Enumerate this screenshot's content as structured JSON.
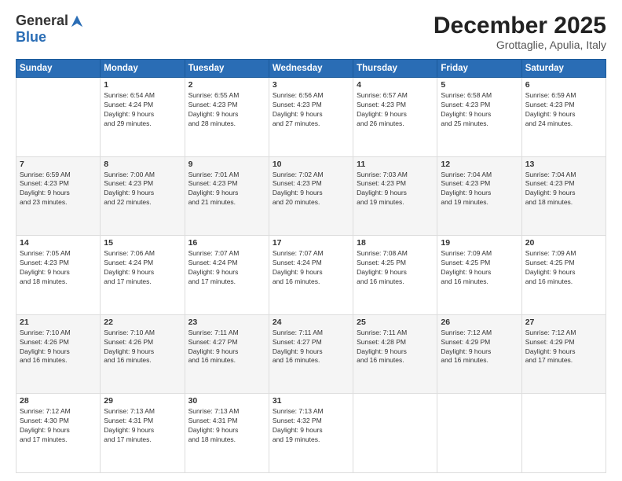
{
  "logo": {
    "general": "General",
    "blue": "Blue"
  },
  "header": {
    "month": "December 2025",
    "location": "Grottaglie, Apulia, Italy"
  },
  "weekdays": [
    "Sunday",
    "Monday",
    "Tuesday",
    "Wednesday",
    "Thursday",
    "Friday",
    "Saturday"
  ],
  "weeks": [
    [
      {
        "day": "",
        "info": ""
      },
      {
        "day": "1",
        "info": "Sunrise: 6:54 AM\nSunset: 4:24 PM\nDaylight: 9 hours\nand 29 minutes."
      },
      {
        "day": "2",
        "info": "Sunrise: 6:55 AM\nSunset: 4:23 PM\nDaylight: 9 hours\nand 28 minutes."
      },
      {
        "day": "3",
        "info": "Sunrise: 6:56 AM\nSunset: 4:23 PM\nDaylight: 9 hours\nand 27 minutes."
      },
      {
        "day": "4",
        "info": "Sunrise: 6:57 AM\nSunset: 4:23 PM\nDaylight: 9 hours\nand 26 minutes."
      },
      {
        "day": "5",
        "info": "Sunrise: 6:58 AM\nSunset: 4:23 PM\nDaylight: 9 hours\nand 25 minutes."
      },
      {
        "day": "6",
        "info": "Sunrise: 6:59 AM\nSunset: 4:23 PM\nDaylight: 9 hours\nand 24 minutes."
      }
    ],
    [
      {
        "day": "7",
        "info": "Sunrise: 6:59 AM\nSunset: 4:23 PM\nDaylight: 9 hours\nand 23 minutes."
      },
      {
        "day": "8",
        "info": "Sunrise: 7:00 AM\nSunset: 4:23 PM\nDaylight: 9 hours\nand 22 minutes."
      },
      {
        "day": "9",
        "info": "Sunrise: 7:01 AM\nSunset: 4:23 PM\nDaylight: 9 hours\nand 21 minutes."
      },
      {
        "day": "10",
        "info": "Sunrise: 7:02 AM\nSunset: 4:23 PM\nDaylight: 9 hours\nand 20 minutes."
      },
      {
        "day": "11",
        "info": "Sunrise: 7:03 AM\nSunset: 4:23 PM\nDaylight: 9 hours\nand 19 minutes."
      },
      {
        "day": "12",
        "info": "Sunrise: 7:04 AM\nSunset: 4:23 PM\nDaylight: 9 hours\nand 19 minutes."
      },
      {
        "day": "13",
        "info": "Sunrise: 7:04 AM\nSunset: 4:23 PM\nDaylight: 9 hours\nand 18 minutes."
      }
    ],
    [
      {
        "day": "14",
        "info": "Sunrise: 7:05 AM\nSunset: 4:23 PM\nDaylight: 9 hours\nand 18 minutes."
      },
      {
        "day": "15",
        "info": "Sunrise: 7:06 AM\nSunset: 4:24 PM\nDaylight: 9 hours\nand 17 minutes."
      },
      {
        "day": "16",
        "info": "Sunrise: 7:07 AM\nSunset: 4:24 PM\nDaylight: 9 hours\nand 17 minutes."
      },
      {
        "day": "17",
        "info": "Sunrise: 7:07 AM\nSunset: 4:24 PM\nDaylight: 9 hours\nand 16 minutes."
      },
      {
        "day": "18",
        "info": "Sunrise: 7:08 AM\nSunset: 4:25 PM\nDaylight: 9 hours\nand 16 minutes."
      },
      {
        "day": "19",
        "info": "Sunrise: 7:09 AM\nSunset: 4:25 PM\nDaylight: 9 hours\nand 16 minutes."
      },
      {
        "day": "20",
        "info": "Sunrise: 7:09 AM\nSunset: 4:25 PM\nDaylight: 9 hours\nand 16 minutes."
      }
    ],
    [
      {
        "day": "21",
        "info": "Sunrise: 7:10 AM\nSunset: 4:26 PM\nDaylight: 9 hours\nand 16 minutes."
      },
      {
        "day": "22",
        "info": "Sunrise: 7:10 AM\nSunset: 4:26 PM\nDaylight: 9 hours\nand 16 minutes."
      },
      {
        "day": "23",
        "info": "Sunrise: 7:11 AM\nSunset: 4:27 PM\nDaylight: 9 hours\nand 16 minutes."
      },
      {
        "day": "24",
        "info": "Sunrise: 7:11 AM\nSunset: 4:27 PM\nDaylight: 9 hours\nand 16 minutes."
      },
      {
        "day": "25",
        "info": "Sunrise: 7:11 AM\nSunset: 4:28 PM\nDaylight: 9 hours\nand 16 minutes."
      },
      {
        "day": "26",
        "info": "Sunrise: 7:12 AM\nSunset: 4:29 PM\nDaylight: 9 hours\nand 16 minutes."
      },
      {
        "day": "27",
        "info": "Sunrise: 7:12 AM\nSunset: 4:29 PM\nDaylight: 9 hours\nand 17 minutes."
      }
    ],
    [
      {
        "day": "28",
        "info": "Sunrise: 7:12 AM\nSunset: 4:30 PM\nDaylight: 9 hours\nand 17 minutes."
      },
      {
        "day": "29",
        "info": "Sunrise: 7:13 AM\nSunset: 4:31 PM\nDaylight: 9 hours\nand 17 minutes."
      },
      {
        "day": "30",
        "info": "Sunrise: 7:13 AM\nSunset: 4:31 PM\nDaylight: 9 hours\nand 18 minutes."
      },
      {
        "day": "31",
        "info": "Sunrise: 7:13 AM\nSunset: 4:32 PM\nDaylight: 9 hours\nand 19 minutes."
      },
      {
        "day": "",
        "info": ""
      },
      {
        "day": "",
        "info": ""
      },
      {
        "day": "",
        "info": ""
      }
    ]
  ]
}
